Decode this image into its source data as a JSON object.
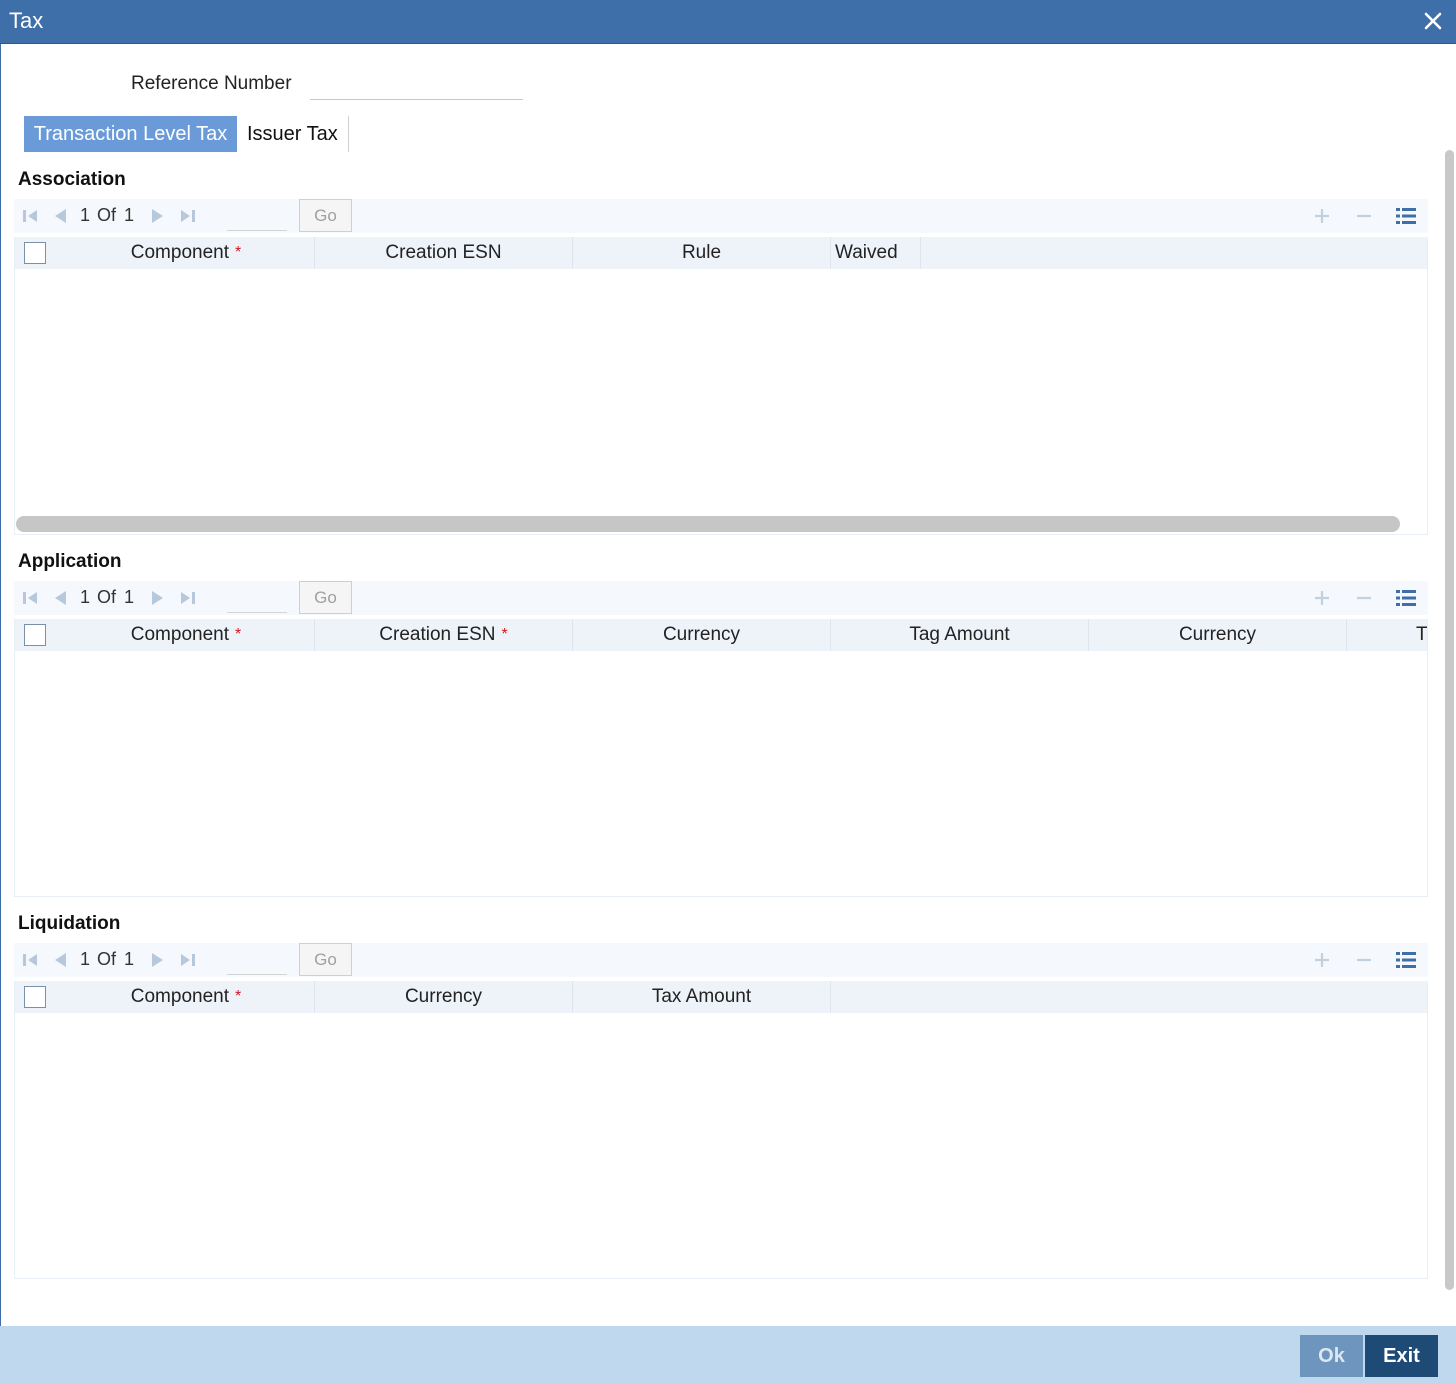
{
  "window": {
    "title": "Tax"
  },
  "reference": {
    "label": "Reference Number",
    "value": ""
  },
  "tabs": [
    {
      "label": "Transaction Level Tax",
      "active": true
    },
    {
      "label": "Issuer Tax",
      "active": false
    }
  ],
  "association": {
    "title": "Association",
    "pagination": {
      "current": "1",
      "of_label": "Of",
      "total": "1",
      "go_label": "Go"
    },
    "columns": [
      "Component",
      "Creation ESN",
      "Rule",
      "Waived"
    ],
    "rows": []
  },
  "application": {
    "title": "Application",
    "pagination": {
      "current": "1",
      "of_label": "Of",
      "total": "1",
      "go_label": "Go"
    },
    "columns": [
      "Component",
      "Creation ESN",
      "Currency",
      "Tag Amount",
      "Currency",
      "T"
    ],
    "rows": []
  },
  "liquidation": {
    "title": "Liquidation",
    "pagination": {
      "current": "1",
      "of_label": "Of",
      "total": "1",
      "go_label": "Go"
    },
    "columns": [
      "Component",
      "Currency",
      "Tax Amount"
    ],
    "rows": []
  },
  "required_marker": "*",
  "footer": {
    "ok_label": "Ok",
    "exit_label": "Exit"
  },
  "colors": {
    "titlebar": "#3f6fa8",
    "active_tab": "#6a9bd8",
    "footer": "#bfd8ee",
    "exit_button": "#1e4a76",
    "required": "#d9121b"
  }
}
